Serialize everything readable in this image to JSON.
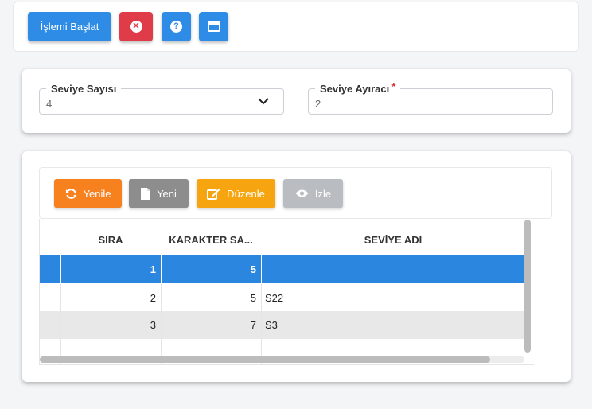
{
  "toolbar": {
    "start_label": "İşlemi Başlat",
    "cancel_icon": "x-circle-icon",
    "help_icon": "question-circle-icon",
    "window_icon": "window-icon"
  },
  "form": {
    "level_count": {
      "label": "Seviye Sayısı",
      "value": "4"
    },
    "level_separator": {
      "label": "Seviye Ayıracı",
      "required_mark": "*",
      "value": "2"
    }
  },
  "grid_toolbar": {
    "refresh_label": "Yenile",
    "new_label": "Yeni",
    "edit_label": "Düzenle",
    "watch_label": "İzle"
  },
  "grid": {
    "columns": [
      "SIRA",
      "KARAKTER SA...",
      "SEVİYE ADI"
    ],
    "rows": [
      {
        "sira": "1",
        "karakter": "5",
        "seviye_adi": ""
      },
      {
        "sira": "2",
        "karakter": "5",
        "seviye_adi": "S22"
      },
      {
        "sira": "3",
        "karakter": "7",
        "seviye_adi": "S3"
      }
    ],
    "selected_row": 1
  },
  "colors": {
    "primary": "#2f8ce6",
    "danger": "#df3b48",
    "refresh": "#f7811f",
    "new": "#8d8d8d",
    "edit": "#f6a511",
    "watch": "#b9bdc2",
    "selected_row": "#2b86e0"
  }
}
